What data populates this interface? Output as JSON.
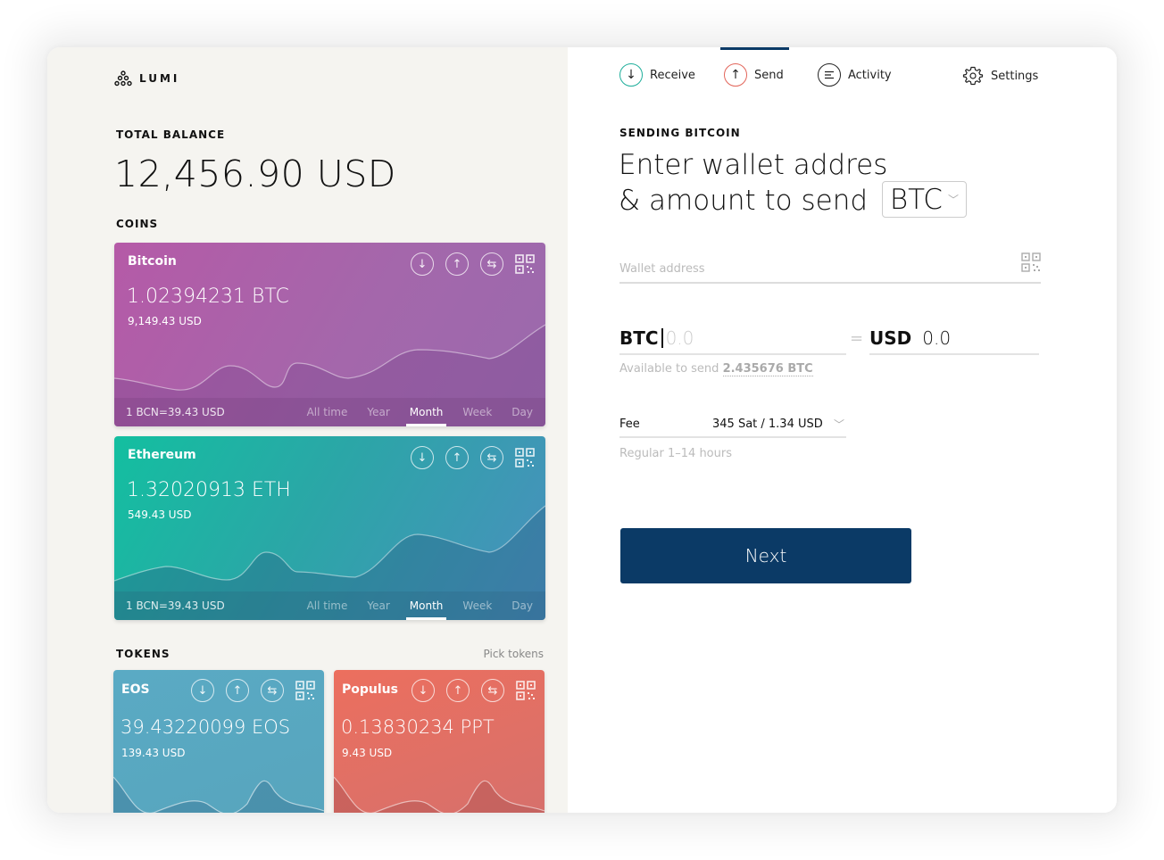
{
  "app": {
    "logo_text": "LUMI"
  },
  "balance": {
    "label": "TOTAL BALANCE",
    "value": "12,456.90 USD"
  },
  "coins": {
    "label": "COINS",
    "items": [
      {
        "name": "Bitcoin",
        "amount": "1.02394231 BTC",
        "usd": "9,149.43 USD",
        "rate": "1 BCN=39.43 USD",
        "ranges": [
          "All time",
          "Year",
          "Month",
          "Week",
          "Day"
        ],
        "active_range": "Month",
        "color_start": "#b55aa7",
        "color_end": "#9a6aad"
      },
      {
        "name": "Ethereum",
        "amount": "1.32020913 ETH",
        "usd": "549.43 USD",
        "rate": "1 BCN=39.43 USD",
        "ranges": [
          "All time",
          "Year",
          "Month",
          "Week",
          "Day"
        ],
        "active_range": "Month",
        "color_start": "#13bfa0",
        "color_end": "#4a8fbe"
      }
    ]
  },
  "tokens": {
    "label": "TOKENS",
    "pick_label": "Pick tokens",
    "items": [
      {
        "name": "EOS",
        "amount": "39.43220099 EOS",
        "usd": "139.43 USD",
        "color": "#5aaac4"
      },
      {
        "name": "Populus",
        "amount": "0.13830234 PPT",
        "usd": "9.43 USD",
        "color": "#ec6f5e"
      }
    ]
  },
  "card_actions": [
    "receive-icon",
    "send-icon",
    "exchange-icon",
    "qr-code-icon"
  ],
  "nav": {
    "items": [
      {
        "label": "Receive",
        "icon": "arrow-down-icon"
      },
      {
        "label": "Send",
        "icon": "arrow-up-icon"
      },
      {
        "label": "Activity",
        "icon": "list-icon"
      },
      {
        "label": "Settings",
        "icon": "gear-icon"
      }
    ],
    "active": "Send"
  },
  "send_form": {
    "section_label": "SENDING BITCOIN",
    "headline_line1": "Enter wallet addres",
    "headline_line2": "& amount to send",
    "currency": "BTC",
    "wallet_placeholder": "Wallet address",
    "amount_unit": "BTC",
    "amount_placeholder": "0.0",
    "equals": "=",
    "usd_unit": "USD",
    "usd_value": "0.0",
    "available_label": "Available to send",
    "available_amount": "2.435676 BTC",
    "fee_label": "Fee",
    "fee_value": "345 Sat / 1.34 USD",
    "fee_note": "Regular 1–14 hours",
    "next_label": "Next"
  },
  "colors": {
    "primary": "#0b3a66",
    "receive": "#1fae9b",
    "send": "#e2655a",
    "left_bg": "#f5f4f0"
  }
}
